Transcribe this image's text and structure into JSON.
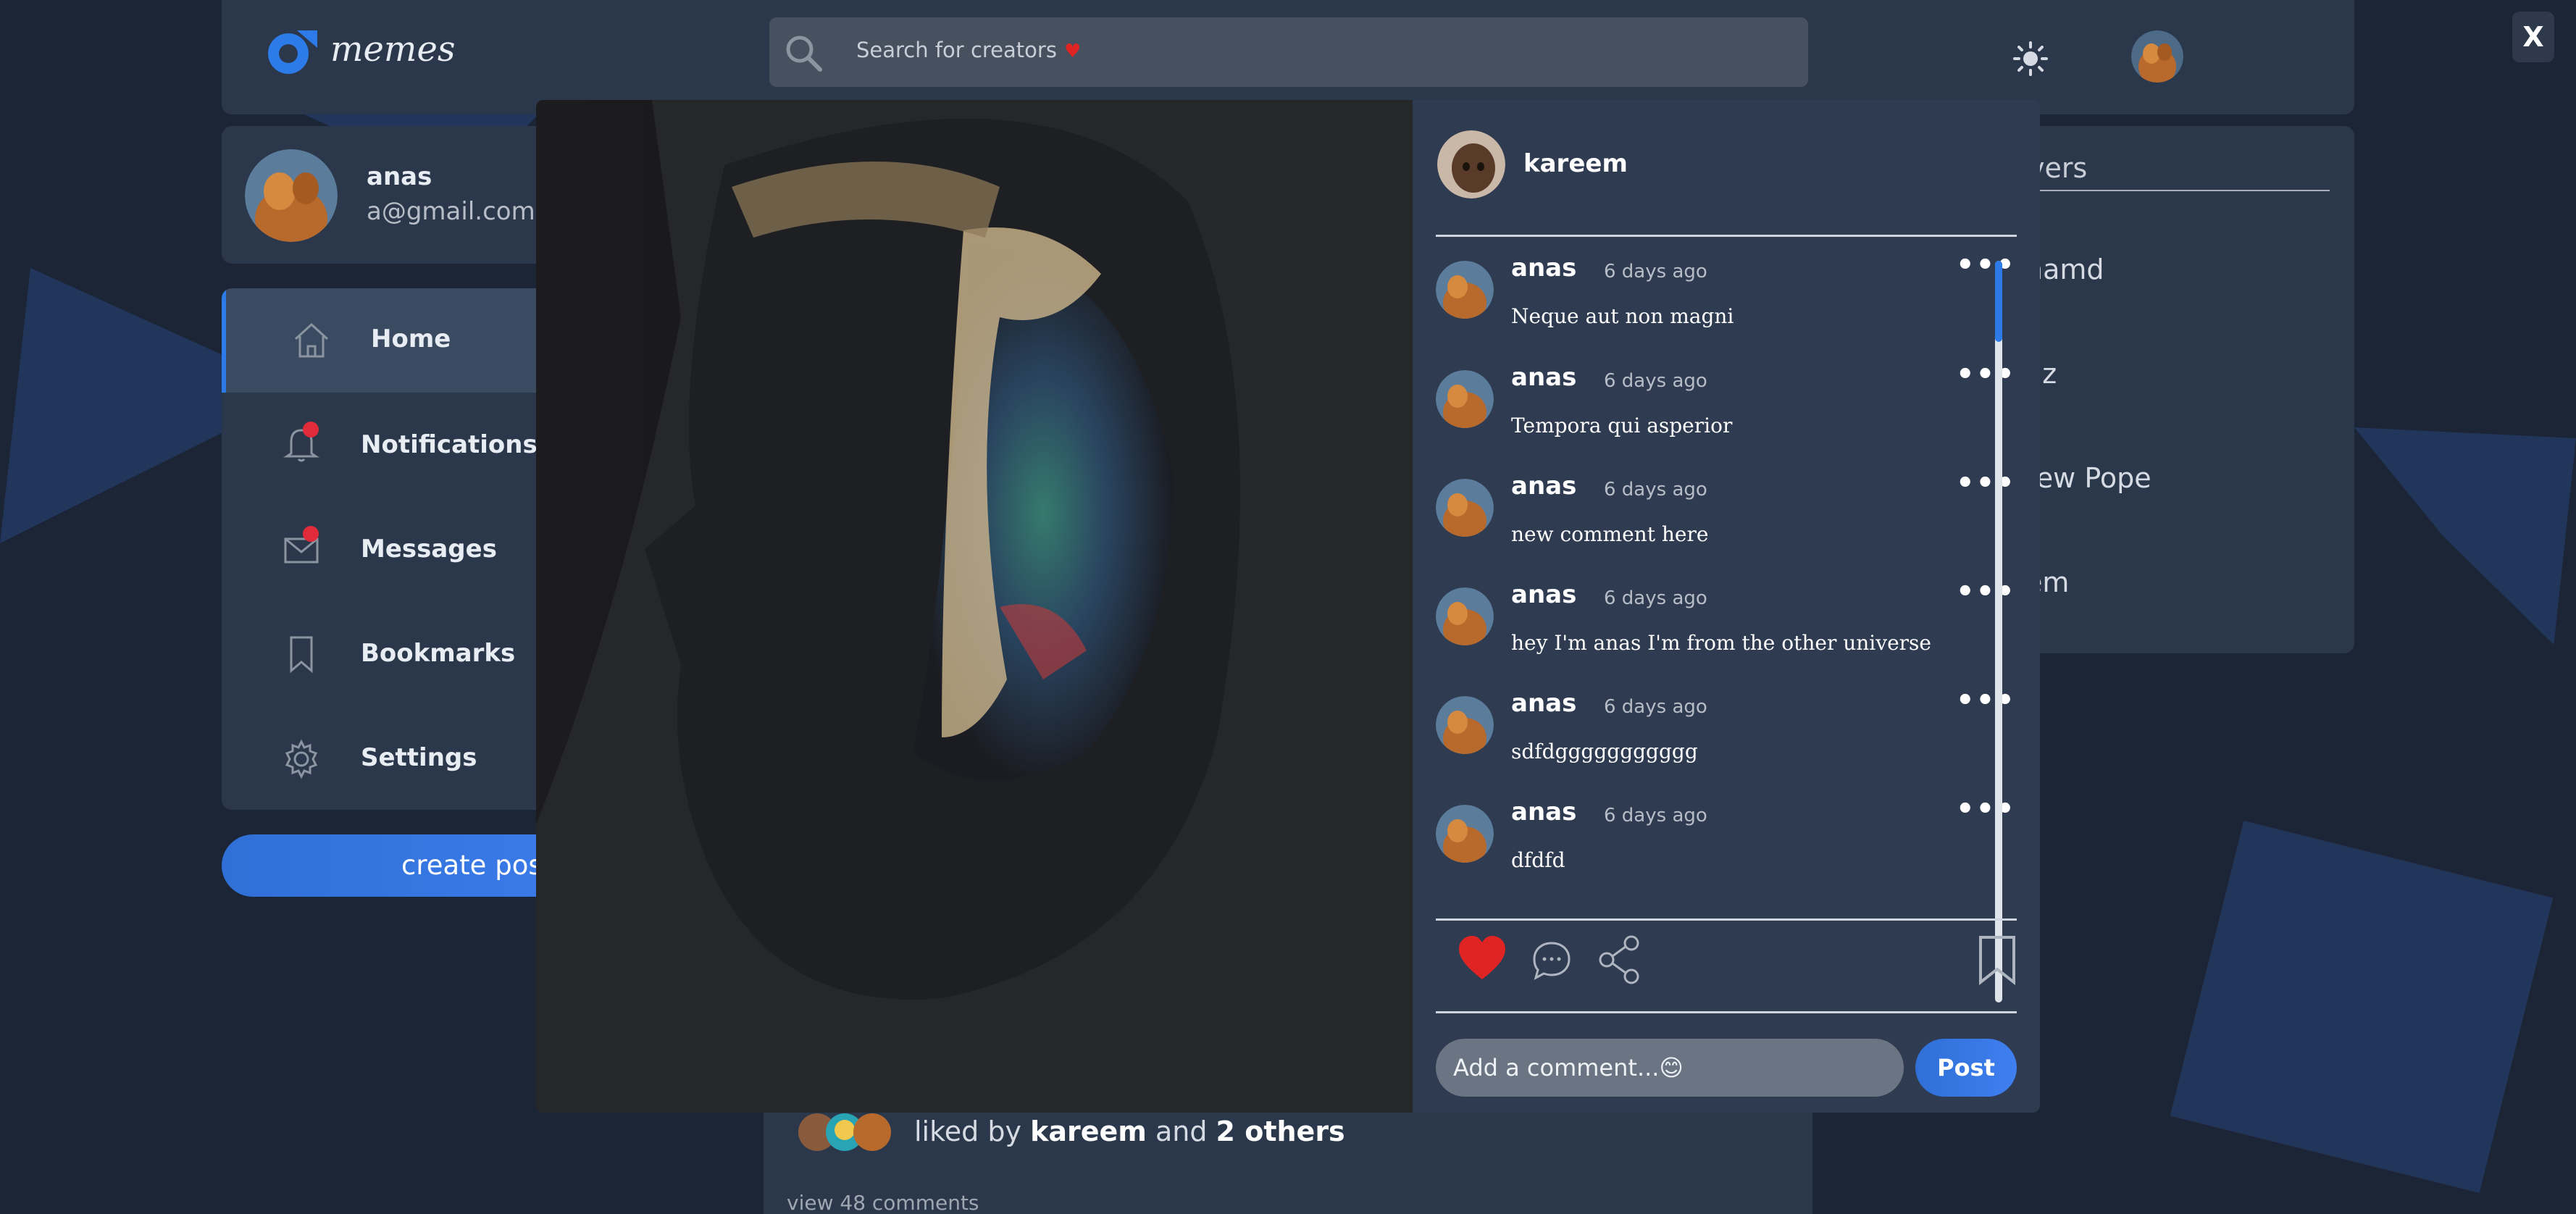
{
  "app": {
    "logo_text": "memes",
    "search_placeholder": "Search for creators",
    "accent_color": "#2d7be8",
    "like_color": "#e02424"
  },
  "profile": {
    "name": "anas",
    "email": "a@gmail.com"
  },
  "nav": {
    "items": [
      {
        "label": "Home",
        "icon": "home-icon",
        "active": true
      },
      {
        "label": "Notifications",
        "icon": "bell-icon",
        "badge": true
      },
      {
        "label": "Messages",
        "icon": "envelope-icon",
        "badge": true
      },
      {
        "label": "Bookmarks",
        "icon": "bookmark-icon"
      },
      {
        "label": "Settings",
        "icon": "gear-icon"
      }
    ]
  },
  "create_post_label": "create pos",
  "right_panel": {
    "title": "vers",
    "items": [
      "hamd",
      "az",
      "rew Pope",
      "em"
    ]
  },
  "feed": {
    "liked_prefix": "liked by",
    "liked_user": "kareem",
    "liked_and": "and",
    "liked_others": "2 others",
    "view_comments": "view 48 comments"
  },
  "close_label": "X",
  "modal": {
    "poster_name": "kareem",
    "comments": [
      {
        "user": "anas",
        "time": "6 days ago",
        "text": "Neque aut non magni"
      },
      {
        "user": "anas",
        "time": "6 days ago",
        "text": "Tempora qui asperior"
      },
      {
        "user": "anas",
        "time": "6 days ago",
        "text": "new comment here"
      },
      {
        "user": "anas",
        "time": "6 days ago",
        "text": "hey I'm anas I'm from the other universe"
      },
      {
        "user": "anas",
        "time": "6 days ago",
        "text": "sdfdggggggggggg"
      },
      {
        "user": "anas",
        "time": "6 days ago",
        "text": "dfdfd"
      }
    ],
    "more_label": "•••",
    "add_comment_placeholder": "Add a comment...😊",
    "post_label": "Post",
    "liked": true
  }
}
